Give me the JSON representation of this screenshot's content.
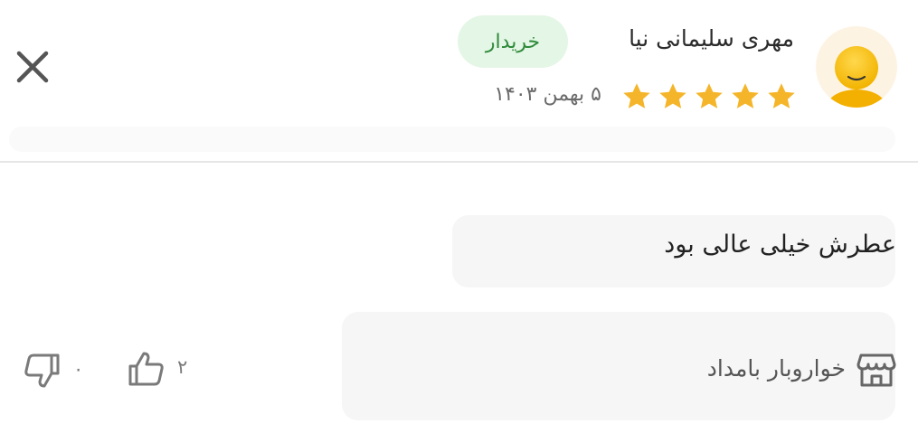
{
  "review": {
    "author_name": "مهری سلیمانی نیا",
    "badge_label": "خریدار",
    "rating": 5,
    "date": "۵ بهمن ۱۴۰۳",
    "comment": "عطرش خیلی عالی بود",
    "store_name": "خواروبار بامداد",
    "likes": "۲",
    "dislikes": "۰"
  },
  "icons": {
    "close": "close-icon",
    "avatar": "user-avatar-icon",
    "star": "star-icon",
    "store": "store-icon",
    "like": "thumbs-up-icon",
    "dislike": "thumbs-down-icon"
  },
  "colors": {
    "badge_bg": "#e4f6e5",
    "badge_text": "#2e8a3a",
    "star": "#f5b52a",
    "avatar_bg": "#fdf3e3",
    "divider": "#e6e6e6"
  }
}
